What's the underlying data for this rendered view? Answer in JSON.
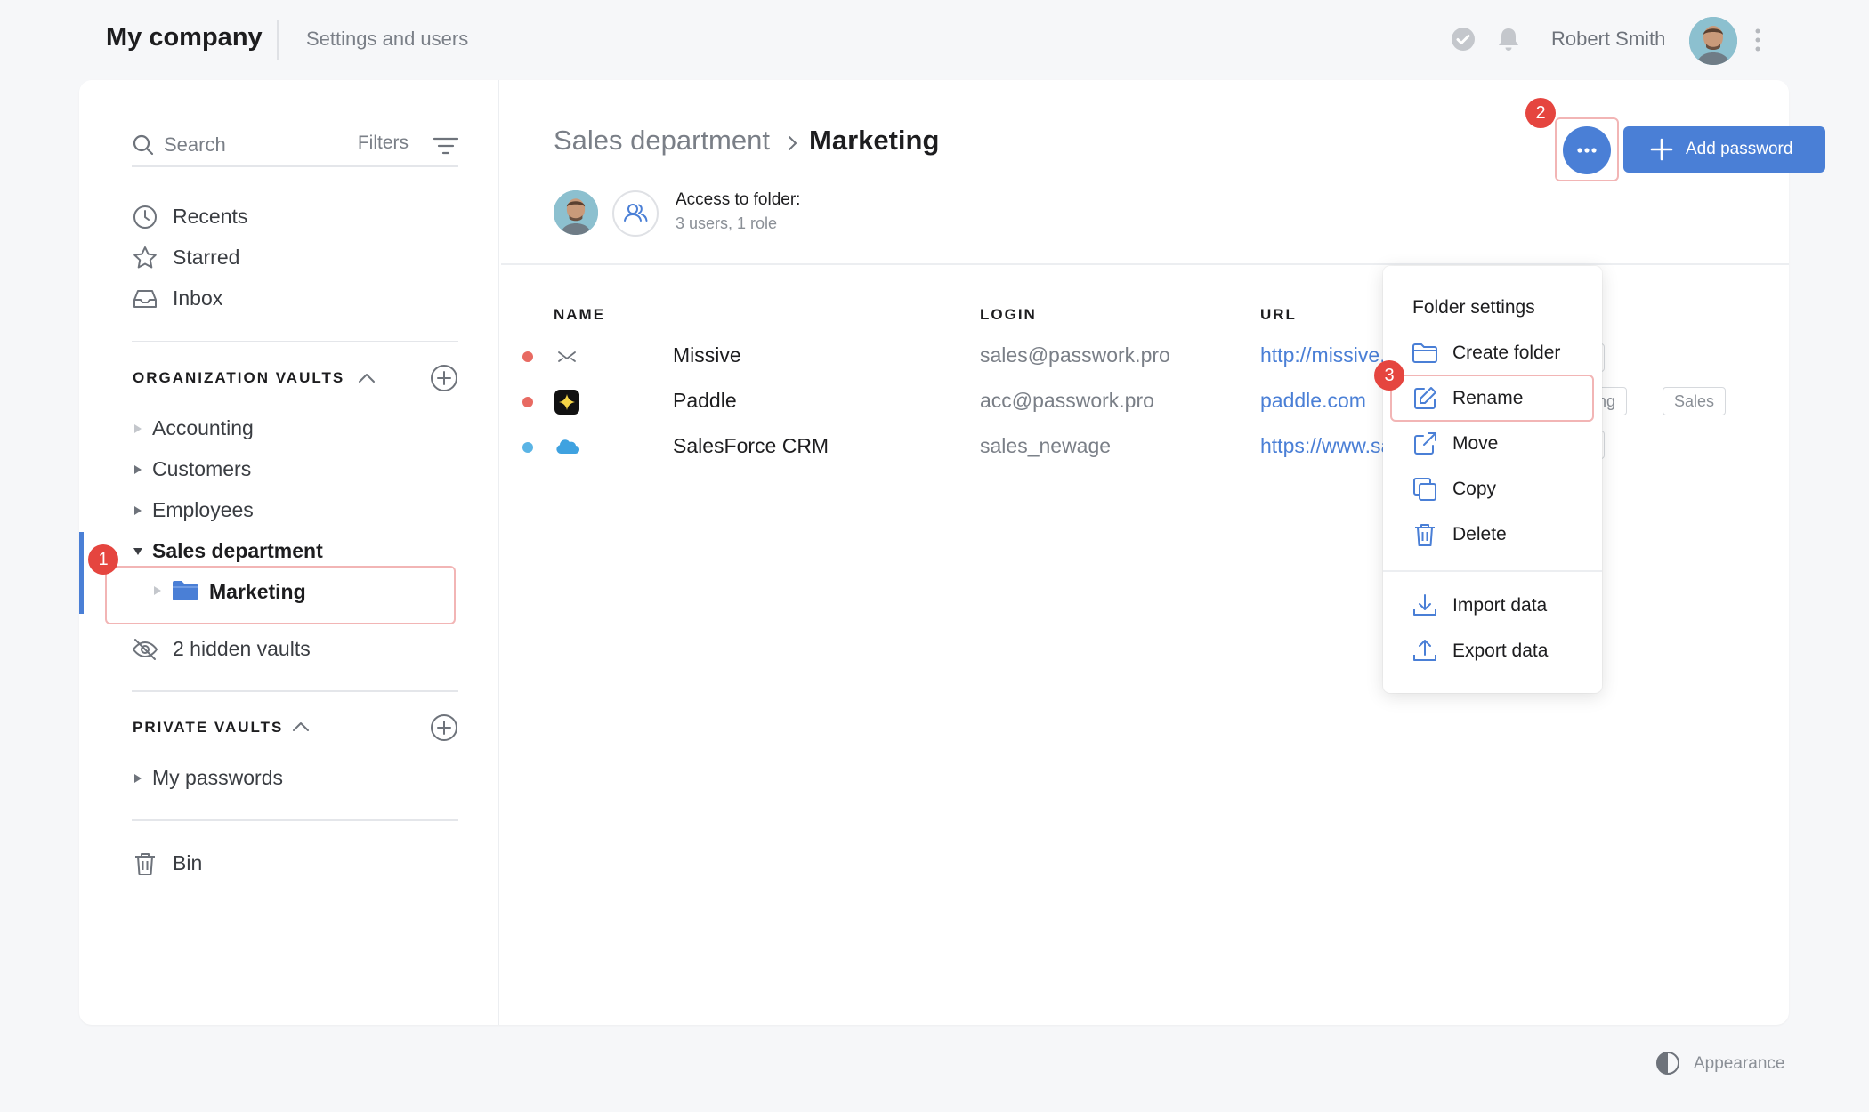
{
  "topbar": {
    "company": "My company",
    "settings_link": "Settings and users",
    "user_name": "Robert Smith"
  },
  "sidebar": {
    "search_placeholder": "Search",
    "filters_label": "Filters",
    "nav": [
      {
        "label": "Recents",
        "icon": "clock-icon"
      },
      {
        "label": "Starred",
        "icon": "star-icon"
      },
      {
        "label": "Inbox",
        "icon": "inbox-icon"
      }
    ],
    "org_vaults_title": "ORGANIZATION VAULTS",
    "org_vaults": [
      {
        "label": "Accounting"
      },
      {
        "label": "Customers"
      },
      {
        "label": "Employees"
      },
      {
        "label": "Sales department"
      }
    ],
    "selected_folder": "Marketing",
    "hidden_vaults": "2 hidden vaults",
    "private_vaults_title": "PRIVATE VAULTS",
    "private_vaults": [
      {
        "label": "My passwords"
      }
    ],
    "bin_label": "Bin"
  },
  "content": {
    "breadcrumb_parent": "Sales department",
    "breadcrumb_current": "Marketing",
    "access_title": "Access to folder:",
    "access_subtitle": "3 users, 1 role",
    "add_password_label": "Add password",
    "columns": {
      "name": "NAME",
      "login": "LOGIN",
      "url": "URL"
    },
    "rows": [
      {
        "name": "Missive",
        "login": "sales@passwork.pro",
        "url": "http://missive.com",
        "status_color": "#e86a62"
      },
      {
        "name": "Paddle",
        "login": "acc@passwork.pro",
        "url": "paddle.com",
        "status_color": "#e86a62"
      },
      {
        "name": "SalesForce CRM",
        "login": "sales_newage",
        "url": "https://www.salesforce.com",
        "status_color": "#5ab4e5"
      }
    ],
    "tags": {
      "accounting_fragment": "nting",
      "sales": "Sales"
    }
  },
  "dropdown": {
    "title": "Folder settings",
    "items": [
      {
        "label": "Create folder",
        "icon": "folder-outline-icon"
      },
      {
        "label": "Rename",
        "icon": "edit-icon"
      },
      {
        "label": "Move",
        "icon": "move-icon"
      },
      {
        "label": "Copy",
        "icon": "copy-icon"
      },
      {
        "label": "Delete",
        "icon": "trash-icon"
      }
    ],
    "secondary_items": [
      {
        "label": "Import data",
        "icon": "download-icon"
      },
      {
        "label": "Export data",
        "icon": "upload-icon"
      }
    ]
  },
  "callouts": {
    "one": "1",
    "two": "2",
    "three": "3"
  },
  "footer": {
    "appearance_label": "Appearance"
  },
  "colors": {
    "accent": "#4a7fd6",
    "callout": "#e5453f",
    "highlight_border": "#f2b5b5"
  }
}
